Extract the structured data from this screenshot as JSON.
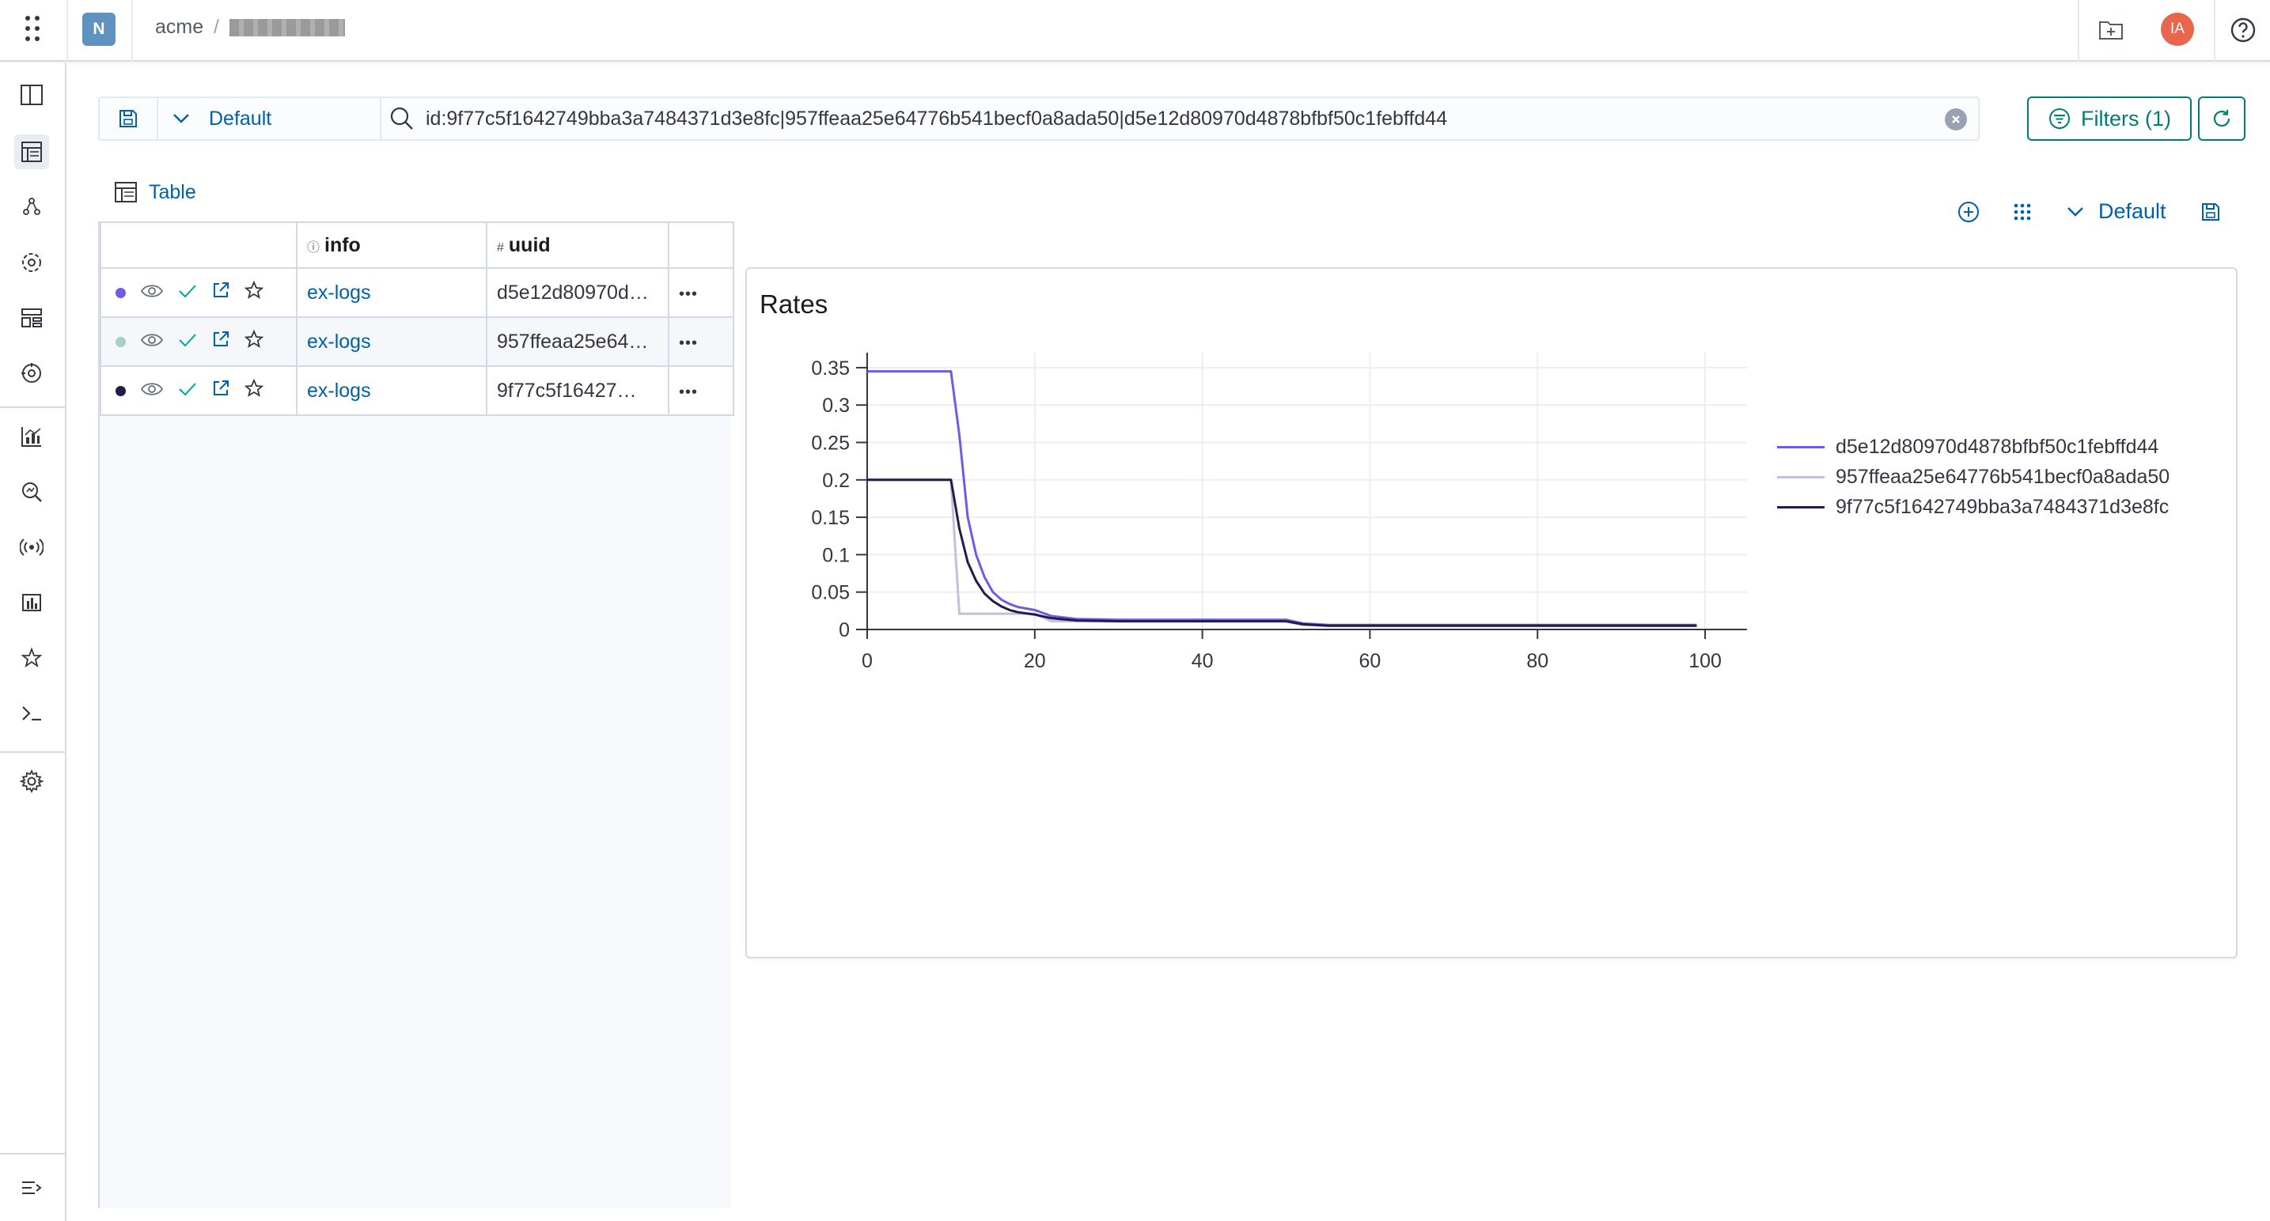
{
  "header": {
    "space_initial": "N",
    "org": "acme",
    "separator": "/",
    "user_initials": "IA",
    "icons": [
      "app-menu-icon",
      "folder-plus-icon",
      "help-icon"
    ]
  },
  "querybar": {
    "default_label": "Default",
    "query": "id:9f77c5f1642749bba3a7484371d3e8fc|957ffeaa25e64776b541becf0a8ada50|d5e12d80970d4878bfbf50c1febffd44",
    "filters_label": "Filters (1)"
  },
  "table": {
    "title": "Table",
    "columns": [
      "info",
      "uuid"
    ],
    "rows": [
      {
        "color": "#6c5ce7",
        "info": "ex-logs",
        "uuid": "d5e12d80970d4878bfbf50c1febffd44",
        "uuid_display": "d5e12d80970d…"
      },
      {
        "color": "#a8cfc9",
        "info": "ex-logs",
        "uuid": "957ffeaa25e64776b541becf0a8ada50",
        "uuid_display": "957ffeaa25e64…"
      },
      {
        "color": "#1f1d4a",
        "info": "ex-logs",
        "uuid": "9f77c5f1642749bba3a7484371d3e8fc",
        "uuid_display": "9f77c5f16427…"
      }
    ],
    "more_label": "•••"
  },
  "panel": {
    "default_label": "Default"
  },
  "chart_data": {
    "type": "line",
    "title": "Rates",
    "xlabel": "",
    "ylabel": "",
    "xlim": [
      0,
      105
    ],
    "ylim": [
      0,
      0.37
    ],
    "xticks": [
      0,
      20,
      40,
      60,
      80,
      100
    ],
    "yticks": [
      0,
      0.05,
      0.1,
      0.15,
      0.2,
      0.25,
      0.3,
      0.35
    ],
    "ytick_labels": [
      "0",
      "0.05",
      "0.1",
      "0.15",
      "0.2",
      "0.25",
      "0.3",
      "0.35"
    ],
    "grid": true,
    "legend_position": "right",
    "series": [
      {
        "name": "d5e12d80970d4878bfbf50c1febffd44",
        "color": "#6c5ce7",
        "x": [
          0,
          10,
          11,
          12,
          13,
          14,
          15,
          16,
          17,
          18,
          20,
          22,
          25,
          30,
          40,
          50,
          52,
          55,
          60,
          80,
          99
        ],
        "y": [
          0.345,
          0.345,
          0.26,
          0.15,
          0.1,
          0.07,
          0.05,
          0.04,
          0.034,
          0.03,
          0.026,
          0.018,
          0.014,
          0.013,
          0.013,
          0.013,
          0.008,
          0.006,
          0.006,
          0.006,
          0.006
        ]
      },
      {
        "name": "957ffeaa25e64776b541becf0a8ada50",
        "color": "#c3c0d8",
        "x": [
          0,
          10,
          11,
          20,
          22,
          25,
          30,
          40,
          50,
          52,
          55,
          60,
          80,
          99
        ],
        "y": [
          0.2,
          0.2,
          0.021,
          0.021,
          0.011,
          0.011,
          0.011,
          0.011,
          0.011,
          0.006,
          0.005,
          0.005,
          0.005,
          0.005
        ]
      },
      {
        "name": "9f77c5f1642749bba3a7484371d3e8fc",
        "color": "#1f1d4a",
        "x": [
          0,
          10,
          11,
          12,
          13,
          14,
          15,
          16,
          17,
          18,
          20,
          22,
          25,
          30,
          40,
          50,
          52,
          55,
          60,
          80,
          99
        ],
        "y": [
          0.2,
          0.2,
          0.135,
          0.09,
          0.065,
          0.048,
          0.038,
          0.031,
          0.026,
          0.023,
          0.02,
          0.015,
          0.012,
          0.011,
          0.011,
          0.011,
          0.007,
          0.005,
          0.005,
          0.005,
          0.005
        ]
      }
    ]
  }
}
